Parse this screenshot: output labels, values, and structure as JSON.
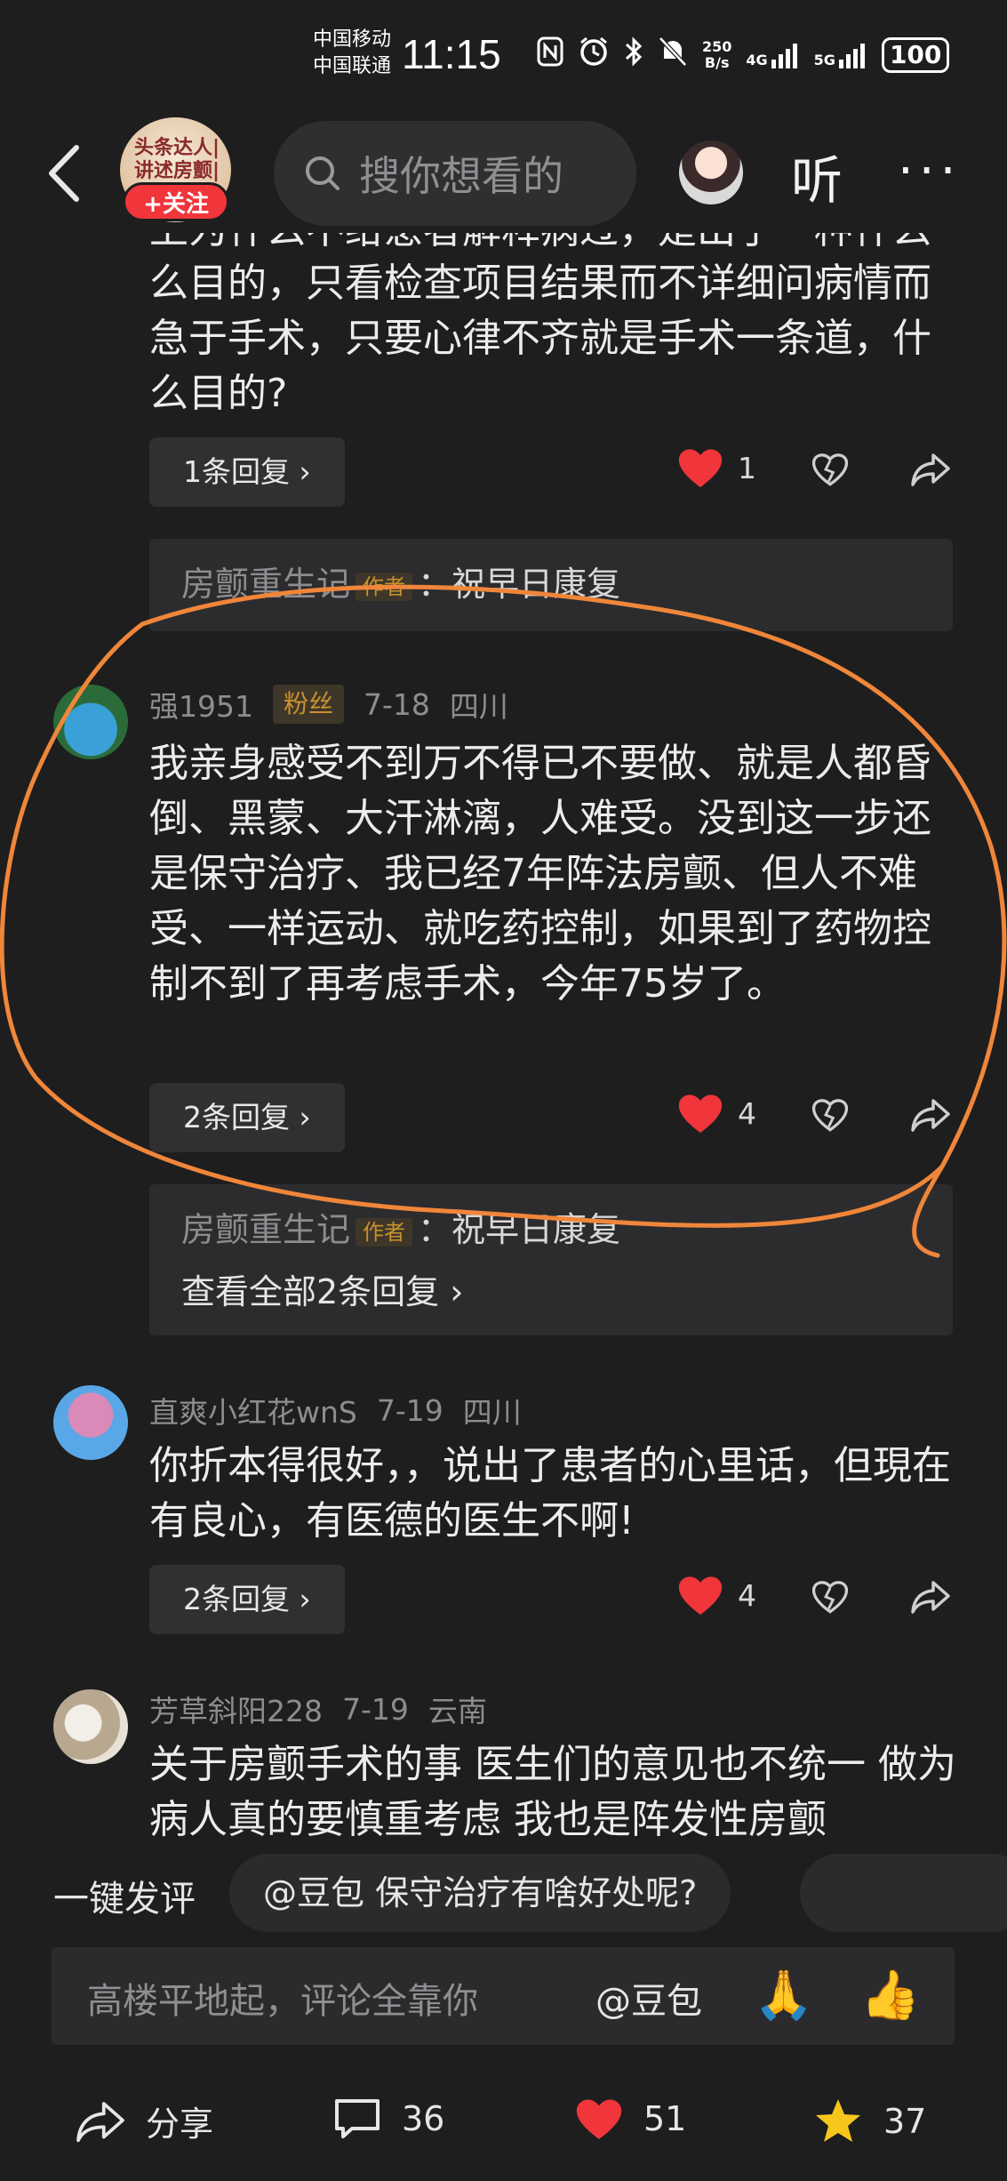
{
  "status_bar": {
    "carrier_1": "中国移动",
    "carrier_2": "中国联通",
    "time": "11:15",
    "net_speed_value": "250",
    "net_speed_unit": "B/s",
    "net_1": "4G",
    "net_2": "5G",
    "battery": "100"
  },
  "header": {
    "channel_avatar_text": "头条达人|讲述房颤|患者自己",
    "follow_label": "+关注",
    "search_placeholder": "搜你想看的",
    "listen_label": "听",
    "more_label": "···"
  },
  "comments": [
    {
      "partial_top_line": "上为什么不给患者解释病过，是出于一种什么",
      "text": "么目的，只看检查项目结果而不详细问病情而急于手术，只要心律不齐就是手术一条道，什么目的?",
      "reply_count_label": "1条回复 ›",
      "likes": "1",
      "replies": [
        {
          "author": "房颤重生记",
          "tag": "作者",
          "text": "：祝早日康复"
        }
      ]
    },
    {
      "username": "强1951",
      "badge": "粉丝",
      "date": "7-18",
      "location": "四川",
      "text": "我亲身感受不到万不得已不要做、就是人都昏倒、黑蒙、大汗淋漓，人难受。没到这一步还是保守治疗、我已经7年阵法房颤、但人不难受、一样运动、就吃药控制，如果到了药物控制不到了再考虑手术，今年75岁了。",
      "reply_count_label": "2条回复 ›",
      "likes": "4",
      "replies": [
        {
          "author": "房颤重生记",
          "tag": "作者",
          "text": "：祝早日康复"
        }
      ],
      "view_all_label": "查看全部2条回复 ›"
    },
    {
      "username": "直爽小红花wnS",
      "date": "7-19",
      "location": "四川",
      "text": "你折本得很好，，说出了患者的心里话，但現在有良心，有医德的医生不啊!",
      "reply_count_label": "2条回复 ›",
      "likes": "4"
    },
    {
      "username": "芳草斜阳228",
      "date": "7-19",
      "location": "云南",
      "text": "关于房颤手术的事 医生们的意见也不统一 做为病人真的要慎重考虑 我也是阵发性房颤"
    }
  ],
  "quick_comment": {
    "label": "一键发评",
    "chip_1": "@豆包 保守治疗有啥好处呢?"
  },
  "comment_input": {
    "placeholder": "高楼平地起，评论全靠你",
    "mention": "@豆包",
    "emoji_1": "🙏",
    "emoji_2": "👍"
  },
  "bottom_bar": {
    "share_label": "分享",
    "comment_count": "36",
    "like_count": "51",
    "favorite_count": "37"
  },
  "colors": {
    "background": "#1e1e1f",
    "heart_red": "#f0353b",
    "star_yellow": "#f7c61b",
    "annotation_orange": "#f0863a",
    "author_tag": "#c8912e"
  }
}
